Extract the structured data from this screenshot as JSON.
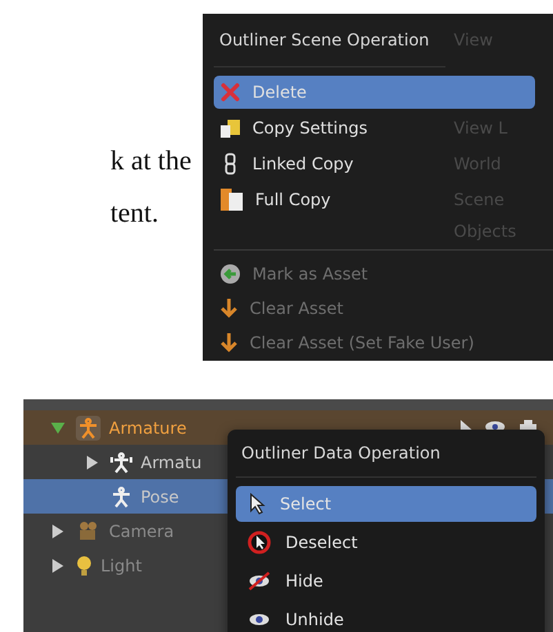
{
  "text_lines": [
    "k at the",
    "tent."
  ],
  "scene_menu": {
    "title": "Outliner Scene Operation",
    "header_background_label": "View",
    "items": [
      {
        "label": "Delete",
        "selected": true,
        "disabled": false
      },
      {
        "label": "Copy Settings",
        "selected": false,
        "disabled": false,
        "background_label": "View L"
      },
      {
        "label": "Linked Copy",
        "selected": false,
        "disabled": false,
        "background_label": "World"
      },
      {
        "label": "Full Copy",
        "selected": false,
        "disabled": false,
        "background_label": "Scene"
      }
    ],
    "background_row": "Objects",
    "asset_items": [
      {
        "label": "Mark as Asset",
        "disabled": true
      },
      {
        "label": "Clear Asset",
        "disabled": true
      },
      {
        "label": "Clear Asset (Set Fake User)",
        "disabled": true
      }
    ]
  },
  "outliner": {
    "rows": [
      {
        "label": "Armature",
        "kind": "armature",
        "active": true,
        "selected": false,
        "expanded": true,
        "children": [
          {
            "label": "Armatu",
            "kind": "armature-data",
            "active": false,
            "selected": false,
            "expanded": false
          },
          {
            "label": "Pose",
            "kind": "pose",
            "active": false,
            "selected": true
          }
        ]
      },
      {
        "label": "Camera",
        "kind": "camera",
        "active": false,
        "selected": false,
        "expanded": false
      },
      {
        "label": "Light",
        "kind": "light",
        "active": false,
        "selected": false,
        "expanded": false
      }
    ]
  },
  "data_menu": {
    "title": "Outliner Data Operation",
    "items": [
      {
        "label": "Select",
        "selected": true
      },
      {
        "label": "Deselect",
        "selected": false
      },
      {
        "label": "Hide",
        "selected": false
      },
      {
        "label": "Unhide",
        "selected": false
      }
    ]
  }
}
